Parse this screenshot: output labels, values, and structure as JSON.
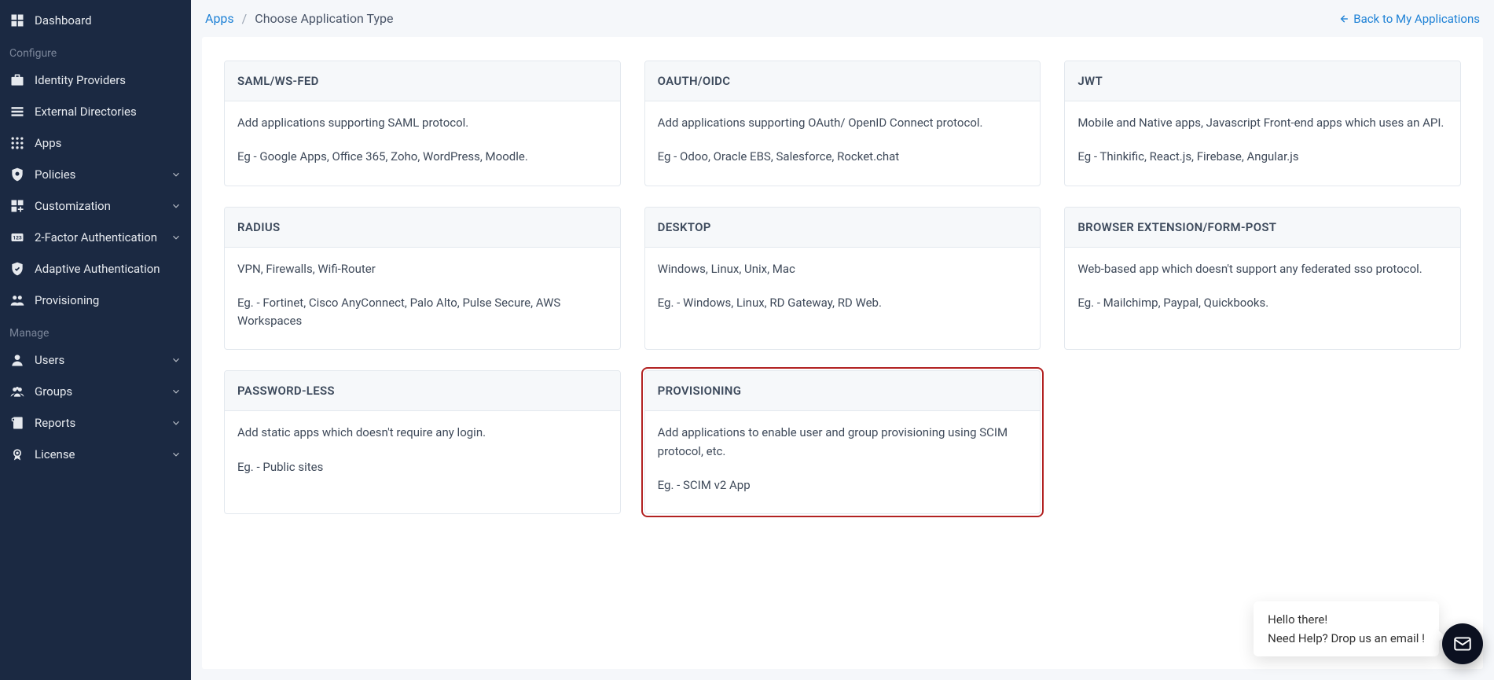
{
  "sidebar": {
    "items": [
      {
        "slug": "dashboard",
        "label": "Dashboard",
        "caret": false,
        "section": "top"
      },
      {
        "slug": "identity-providers",
        "label": "Identity Providers",
        "caret": false,
        "section": "configure"
      },
      {
        "slug": "external-directories",
        "label": "External Directories",
        "caret": false,
        "section": "configure"
      },
      {
        "slug": "apps",
        "label": "Apps",
        "caret": false,
        "section": "configure"
      },
      {
        "slug": "policies",
        "label": "Policies",
        "caret": true,
        "section": "configure"
      },
      {
        "slug": "customization",
        "label": "Customization",
        "caret": true,
        "section": "configure"
      },
      {
        "slug": "two-factor-auth",
        "label": "2-Factor Authentication",
        "caret": true,
        "section": "configure"
      },
      {
        "slug": "adaptive-auth",
        "label": "Adaptive Authentication",
        "caret": false,
        "section": "configure"
      },
      {
        "slug": "provisioning",
        "label": "Provisioning",
        "caret": false,
        "section": "configure"
      },
      {
        "slug": "users",
        "label": "Users",
        "caret": true,
        "section": "manage"
      },
      {
        "slug": "groups",
        "label": "Groups",
        "caret": true,
        "section": "manage"
      },
      {
        "slug": "reports",
        "label": "Reports",
        "caret": true,
        "section": "manage"
      },
      {
        "slug": "license",
        "label": "License",
        "caret": true,
        "section": "manage"
      }
    ],
    "sections": {
      "configure": "Configure",
      "manage": "Manage"
    }
  },
  "breadcrumb": {
    "root": "Apps",
    "current": "Choose Application Type"
  },
  "back_link": "Back to My Applications",
  "cards": [
    {
      "slug": "saml",
      "title": "SAML/WS-FED",
      "desc": "Add applications supporting SAML protocol.",
      "example": "Eg - Google Apps, Office 365, Zoho, WordPress, Moodle.",
      "highlight": false
    },
    {
      "slug": "oauth",
      "title": "OAUTH/OIDC",
      "desc": "Add applications supporting OAuth/ OpenID Connect protocol.",
      "example": "Eg - Odoo, Oracle EBS, Salesforce, Rocket.chat",
      "highlight": false
    },
    {
      "slug": "jwt",
      "title": "JWT",
      "desc": "Mobile and Native apps, Javascript Front-end apps which uses an API.",
      "example": "Eg - Thinkific, React.js, Firebase, Angular.js",
      "highlight": false
    },
    {
      "slug": "radius",
      "title": "RADIUS",
      "desc": "VPN, Firewalls, Wifi-Router",
      "example": "Eg. - Fortinet, Cisco AnyConnect, Palo Alto, Pulse Secure, AWS Workspaces",
      "highlight": false
    },
    {
      "slug": "desktop",
      "title": "DESKTOP",
      "desc": "Windows, Linux, Unix, Mac",
      "example": "Eg. - Windows, Linux, RD Gateway, RD Web.",
      "highlight": false
    },
    {
      "slug": "browser-ext",
      "title": "BROWSER EXTENSION/FORM-POST",
      "desc": "Web-based app which doesn't support any federated sso protocol.",
      "example": "Eg. - Mailchimp, Paypal, Quickbooks.",
      "highlight": false
    },
    {
      "slug": "passwordless",
      "title": "PASSWORD-LESS",
      "desc": "Add static apps which doesn't require any login.",
      "example": "Eg. - Public sites",
      "highlight": false
    },
    {
      "slug": "provisioning-card",
      "title": "PROVISIONING",
      "desc": "Add applications to enable user and group provisioning using SCIM protocol, etc.",
      "example": "Eg. - SCIM v2 App",
      "highlight": true
    }
  ],
  "chat": {
    "line1": "Hello there!",
    "line2": "Need Help? Drop us an email !"
  }
}
